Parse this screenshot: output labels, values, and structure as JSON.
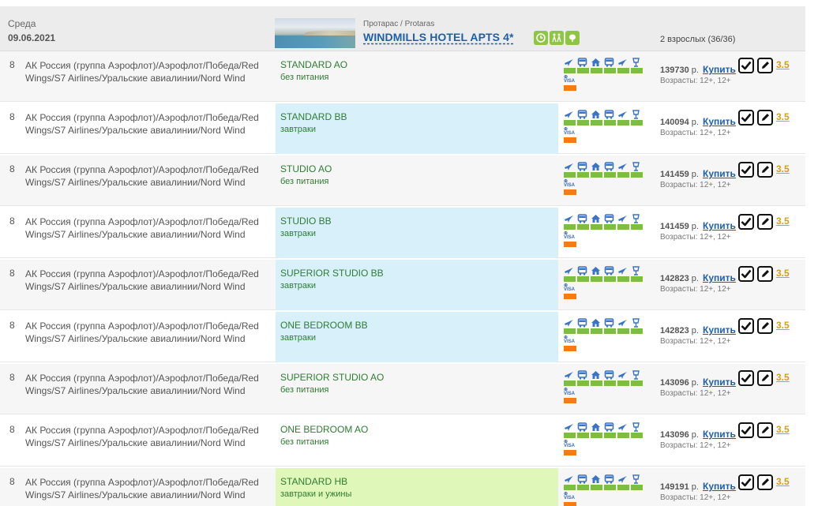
{
  "header": {
    "day": "Среда",
    "date": "09.06.2021",
    "region": "Протарас / Protaras",
    "hotel": "WINDMILLS HOTEL APTS 4*",
    "guests": "2 взрослых (36/36)",
    "amenity_icons": [
      "clock-icon",
      "people-icon",
      "plant-icon"
    ]
  },
  "colors": {
    "room_bg_bb": "#d7f0fa",
    "room_bg_hb": "#dff7b9",
    "service_icon": "#3a74c4",
    "bar": "#7cbf40",
    "orange": "#f57c12",
    "rating": "#d4a017",
    "link": "#1d5fa8"
  },
  "service_icons": [
    "plane-icon",
    "bus-icon",
    "hotel-icon",
    "bus-icon",
    "plane-icon",
    "insurance-icon"
  ],
  "labels": {
    "buy": "Купить",
    "currency": "р.",
    "visa": "VISA"
  },
  "rows": [
    {
      "num": "8",
      "airline": "АК Россия (группа Аэрофлот)/Аэрофлот/Победа/Red Wings/S7 Airlines/Уральские авиалинии/Nord Wind",
      "room": "STANDARD AO",
      "meal": "без питания",
      "room_bg": "none",
      "price": "139730",
      "ages": "Возрасты: 12+, 12+",
      "rating": "3.5"
    },
    {
      "num": "8",
      "airline": "АК Россия (группа Аэрофлот)/Аэрофлот/Победа/Red Wings/S7 Airlines/Уральские авиалинии/Nord Wind",
      "room": "STANDARD BB",
      "meal": "завтраки",
      "room_bg": "bb",
      "price": "140094",
      "ages": "Возрасты: 12+, 12+",
      "rating": "3.5"
    },
    {
      "num": "8",
      "airline": "АК Россия (группа Аэрофлот)/Аэрофлот/Победа/Red Wings/S7 Airlines/Уральские авиалинии/Nord Wind",
      "room": "STUDIO AO",
      "meal": "без питания",
      "room_bg": "none",
      "price": "141459",
      "ages": "Возрасты: 12+, 12+",
      "rating": "3.5"
    },
    {
      "num": "8",
      "airline": "АК Россия (группа Аэрофлот)/Аэрофлот/Победа/Red Wings/S7 Airlines/Уральские авиалинии/Nord Wind",
      "room": "STUDIO BB",
      "meal": "завтраки",
      "room_bg": "bb",
      "price": "141459",
      "ages": "Возрасты: 12+, 12+",
      "rating": "3.5"
    },
    {
      "num": "8",
      "airline": "АК Россия (группа Аэрофлот)/Аэрофлот/Победа/Red Wings/S7 Airlines/Уральские авиалинии/Nord Wind",
      "room": "SUPERIOR STUDIO BB",
      "meal": "завтраки",
      "room_bg": "bb",
      "price": "142823",
      "ages": "Возрасты: 12+, 12+",
      "rating": "3.5"
    },
    {
      "num": "8",
      "airline": "АК Россия (группа Аэрофлот)/Аэрофлот/Победа/Red Wings/S7 Airlines/Уральские авиалинии/Nord Wind",
      "room": "ONE BEDROOM BB",
      "meal": "завтраки",
      "room_bg": "bb",
      "price": "142823",
      "ages": "Возрасты: 12+, 12+",
      "rating": "3.5"
    },
    {
      "num": "8",
      "airline": "АК Россия (группа Аэрофлот)/Аэрофлот/Победа/Red Wings/S7 Airlines/Уральские авиалинии/Nord Wind",
      "room": "SUPERIOR STUDIO AO",
      "meal": "без питания",
      "room_bg": "none",
      "price": "143096",
      "ages": "Возрасты: 12+, 12+",
      "rating": "3.5"
    },
    {
      "num": "8",
      "airline": "АК Россия (группа Аэрофлот)/Аэрофлот/Победа/Red Wings/S7 Airlines/Уральские авиалинии/Nord Wind",
      "room": "ONE BEDROOM AO",
      "meal": "без питания",
      "room_bg": "none",
      "price": "143096",
      "ages": "Возрасты: 12+, 12+",
      "rating": "3.5"
    },
    {
      "num": "8",
      "airline": "АК Россия (группа Аэрофлот)/Аэрофлот/Победа/Red Wings/S7 Airlines/Уральские авиалинии/Nord Wind",
      "room": "STANDARD HB",
      "meal": "завтраки и ужины",
      "room_bg": "hb",
      "price": "149191",
      "ages": "Возрасты: 12+, 12+",
      "rating": "3.5"
    }
  ]
}
